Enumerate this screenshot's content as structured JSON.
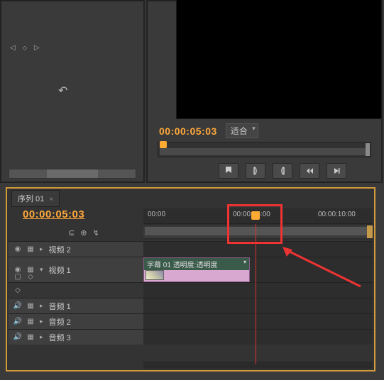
{
  "preview": {
    "timecode": "00:00:05:03",
    "fit_label": "适合"
  },
  "timeline": {
    "tab_name": "序列 01",
    "timecode": "00:00:05:03",
    "ruler_marks": [
      "00:00",
      "00:00:05:00",
      "00:00:10:00"
    ],
    "tracks": {
      "v2": "视频 2",
      "v1": "视频 1",
      "a1": "音频 1",
      "a2": "音频 2",
      "a3": "音频 3"
    },
    "clip": {
      "name": "字幕 01",
      "effect_label": "透明度:透明度"
    }
  }
}
